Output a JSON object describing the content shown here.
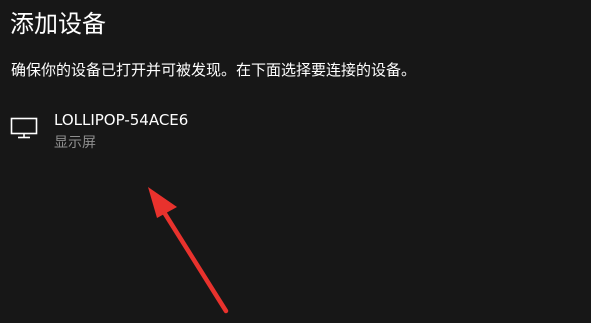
{
  "dialog": {
    "title": "添加设备",
    "instruction": "确保你的设备已打开并可被发现。在下面选择要连接的设备。"
  },
  "devices": [
    {
      "name": "LOLLIPOP-54ACE6",
      "type": "显示屏",
      "icon": "monitor-icon"
    }
  ],
  "annotation": {
    "icon": "red-arrow-annotation",
    "color": "#e8322d"
  },
  "colors": {
    "background": "#171717",
    "primary_text": "#ffffff",
    "secondary_text": "#8f8f8f"
  }
}
